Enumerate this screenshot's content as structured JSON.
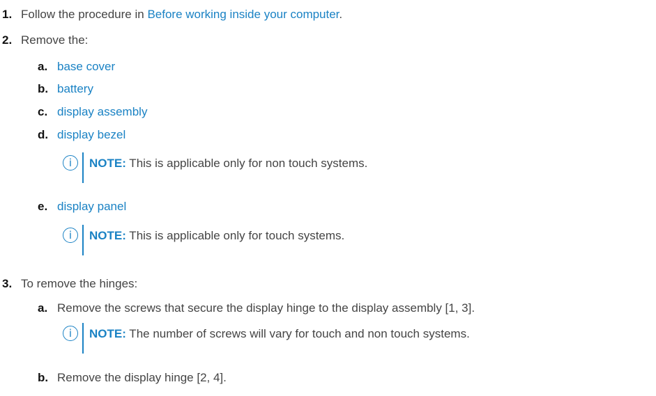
{
  "steps": [
    {
      "number": "1.",
      "prefix": "Follow the procedure in ",
      "link": "Before working inside your computer",
      "suffix": "."
    },
    {
      "number": "2.",
      "text": "Remove the:",
      "substeps": [
        {
          "letter": "a.",
          "link": "base cover"
        },
        {
          "letter": "b.",
          "link": "battery"
        },
        {
          "letter": "c.",
          "link": "display assembly"
        },
        {
          "letter": "d.",
          "link": "display bezel",
          "note": {
            "label": "NOTE:",
            "text": " This is applicable only for non touch systems."
          }
        },
        {
          "letter": "e.",
          "link": "display panel",
          "note": {
            "label": "NOTE:",
            "text": " This is applicable only for touch systems."
          }
        }
      ]
    },
    {
      "number": "3.",
      "text": "To remove the hinges:",
      "substeps": [
        {
          "letter": "a.",
          "text": "Remove the screws that secure the display hinge to the display assembly [1, 3].",
          "note": {
            "label": "NOTE:",
            "text": " The number of screws will vary for touch and non touch systems."
          }
        },
        {
          "letter": "b.",
          "text": "Remove the display hinge [2, 4]."
        }
      ]
    }
  ],
  "icons": {
    "note": "info-icon"
  },
  "colors": {
    "link": "#1a82c4",
    "text": "#444444",
    "number": "#111111"
  }
}
